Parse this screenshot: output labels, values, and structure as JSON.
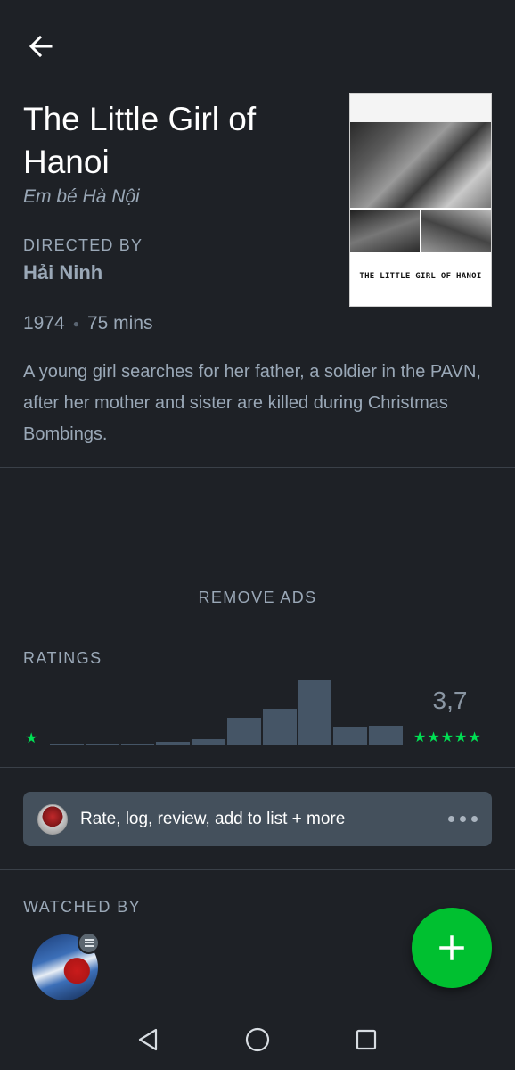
{
  "film": {
    "title": "The Little Girl of Hanoi",
    "original_title": "Em bé Hà Nội",
    "directed_by_label": "DIRECTED BY",
    "director": "Hải Ninh",
    "year": "1974",
    "runtime": "75 mins",
    "synopsis": "A young girl searches for her father, a soldier in the PAVN, after her mother and sister are killed during Christmas Bombings.",
    "poster_text": "THE LITTLE GIRL OF HANOI"
  },
  "ads": {
    "remove_label": "REMOVE ADS"
  },
  "ratings": {
    "label": "RATINGS",
    "average": "3,7",
    "min_stars": "★",
    "max_stars": "★★★★★",
    "distribution": [
      0.01,
      0.01,
      0.02,
      0.04,
      0.09,
      0.42,
      0.56,
      1.0,
      0.28,
      0.29
    ]
  },
  "action_bar": {
    "label": "Rate, log, review, add to list + more"
  },
  "watched_by": {
    "label": "WATCHED BY"
  },
  "colors": {
    "accent_green": "#00e054",
    "fab_green": "#00c030",
    "background": "#1e2126",
    "bar": "#455566",
    "muted_text": "#9aa8b7"
  },
  "icons": {
    "back": "arrow-left-icon",
    "add": "plus-icon",
    "more": "more-horizontal-icon",
    "list": "list-icon",
    "nav_back": "triangle-back-icon",
    "nav_home": "circle-home-icon",
    "nav_recents": "square-recents-icon"
  }
}
